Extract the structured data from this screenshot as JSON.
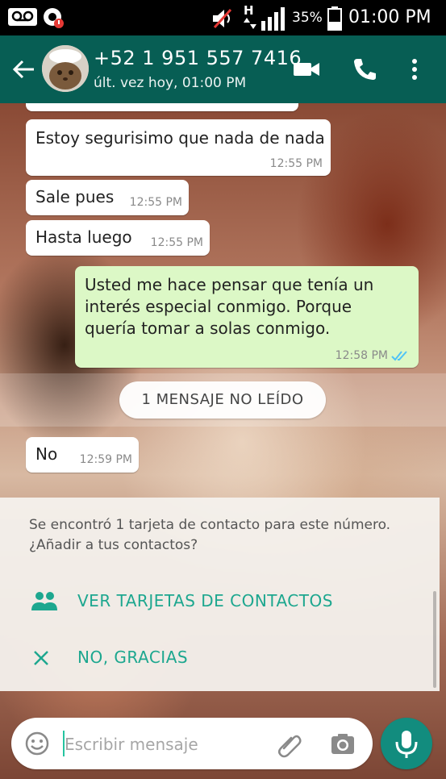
{
  "status_bar": {
    "battery": "35%",
    "network_type": "H",
    "time": "01:00 PM"
  },
  "header": {
    "contact_name": "+52 1 951 557 7416",
    "last_seen": "últ. vez hoy, 01:00 PM"
  },
  "messages": [
    {
      "direction": "in",
      "text": "Estoy segurisimo que nada de nada",
      "time": "12:55 PM"
    },
    {
      "direction": "in",
      "text": "Sale pues",
      "time": "12:55 PM"
    },
    {
      "direction": "in",
      "text": "Hasta luego",
      "time": "12:55 PM"
    },
    {
      "direction": "out",
      "text": "Usted me hace pensar que tenía un\ninterés especial conmigo. Porque\nquería tomar a solas conmigo.",
      "time": "12:58 PM",
      "status": "read"
    },
    {
      "direction": "in",
      "text": "No",
      "time": "12:59 PM"
    }
  ],
  "unread_divider": "1 MENSAJE NO LEÍDO",
  "contact_card_prompt": {
    "text": "Se encontró 1 tarjeta de contacto para este número.\n¿Añadir a tus contactos?",
    "view_label": "VER TARJETAS DE CONTACTOS",
    "dismiss_label": "NO, GRACIAS"
  },
  "composer": {
    "placeholder": "Escribir mensaje"
  },
  "colors": {
    "header": "#075E54",
    "outgoing_bubble": "#DCF8C6",
    "accent": "#1DA78F",
    "mic_button": "#128C7E"
  }
}
